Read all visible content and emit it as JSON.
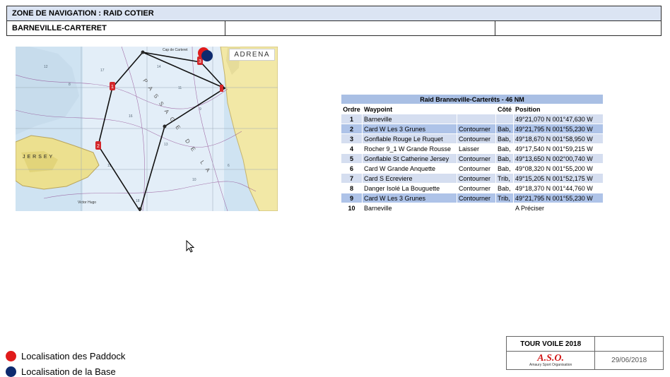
{
  "header": {
    "title": "ZONE DE NAVIGATION : RAID COTIER",
    "location": "BARNEVILLE-CARTERET"
  },
  "map": {
    "badge": "ADRENA",
    "place_labels": {
      "cap": "Cap de Carteret",
      "island": "JERSEY",
      "passage": "PASSAGE DE LA",
      "town": "Victor Hugo"
    },
    "waypoint_marks": [
      "1",
      "2",
      "3"
    ]
  },
  "table": {
    "caption": "Raid Branneville-Carterêts - 46 NM",
    "headers": {
      "order": "Ordre",
      "waypoint": "Waypoint",
      "side": "Côté",
      "position": "Position"
    },
    "rows": [
      {
        "order": "1",
        "waypoint": "Barneville",
        "action": "",
        "side": "",
        "position": "49°21,070 N  001°47,630 W"
      },
      {
        "order": "2",
        "waypoint": "Card W Les 3 Grunes",
        "action": "Contourner",
        "side": "Bab,",
        "position": "49°21,795 N  001°55,230 W"
      },
      {
        "order": "3",
        "waypoint": "Gonflable Rouge Le Ruquet",
        "action": "Contourner",
        "side": "Bab,",
        "position": "49°18,670 N  001°58,950 W"
      },
      {
        "order": "4",
        "waypoint": "Rocher 9_1 W Grande Rousse",
        "action": "Laisser",
        "side": "Bab,",
        "position": "49°17,540 N  001°59,215 W"
      },
      {
        "order": "5",
        "waypoint": "Gonflable St Catherine Jersey",
        "action": "Contourner",
        "side": "Bab,",
        "position": "49°13,650 N  002°00,740 W"
      },
      {
        "order": "6",
        "waypoint": "Card W Grande Anquette",
        "action": "Contourner",
        "side": "Bab,",
        "position": "49°08,320 N  001°55,200 W"
      },
      {
        "order": "7",
        "waypoint": "Card S Ecreviere",
        "action": "Contourner",
        "side": "Trib,",
        "position": "49°15,205 N  001°52,175 W"
      },
      {
        "order": "8",
        "waypoint": "Danger Isolé La Bouguette",
        "action": "Contourner",
        "side": "Bab,",
        "position": "49°18,370 N  001°44,760 W"
      },
      {
        "order": "9",
        "waypoint": "Card W Les 3 Grunes",
        "action": "Contourner",
        "side": "Trib,",
        "position": "49°21,795 N  001°55,230 W"
      },
      {
        "order": "10",
        "waypoint": "Barneville",
        "action": "",
        "side": "",
        "position": "A Préciser"
      }
    ]
  },
  "legend": [
    {
      "label": "Localisation des Paddock",
      "color": "#e01b1b"
    },
    {
      "label": "Localisation de la Base",
      "color": "#0d2a6e"
    }
  ],
  "footer": {
    "event": "TOUR VOILE 2018",
    "logo_text": "A.S.O.",
    "logo_sub": "Amaury Sport Organisation",
    "date": "29/06/2018"
  }
}
